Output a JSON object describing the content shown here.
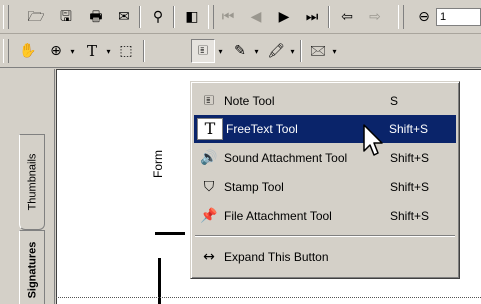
{
  "toolbar1": {
    "buttons": [
      {
        "name": "open-icon",
        "glyph": "🗁"
      },
      {
        "name": "save-icon",
        "glyph": "🖫"
      },
      {
        "name": "print-icon",
        "glyph": "🖶"
      },
      {
        "name": "email-icon",
        "glyph": "✉"
      },
      {
        "name": "find-icon",
        "glyph": "⚲"
      },
      {
        "name": "show-navigation-pane-icon",
        "glyph": "◧"
      },
      {
        "name": "first-page-icon",
        "glyph": "⏮"
      },
      {
        "name": "previous-page-icon",
        "glyph": "◀"
      },
      {
        "name": "next-page-icon",
        "glyph": "▶"
      },
      {
        "name": "last-page-icon",
        "glyph": "⏭"
      },
      {
        "name": "go-back-icon",
        "glyph": "⇦"
      },
      {
        "name": "go-forward-icon",
        "glyph": "⇨"
      },
      {
        "name": "zoom-out-icon",
        "glyph": "⊖"
      }
    ],
    "zoom_field_partial": "1"
  },
  "toolbar2": {
    "buttons": [
      {
        "name": "hand-tool-icon",
        "glyph": "✋"
      },
      {
        "name": "zoom-in-tool-icon",
        "glyph": "⊕"
      },
      {
        "name": "text-select-tool-icon",
        "glyph": "T"
      },
      {
        "name": "graphics-select-tool-icon",
        "glyph": "⬚"
      },
      {
        "name": "note-tool-icon",
        "glyph": "🗉"
      },
      {
        "name": "pencil-tool-icon",
        "glyph": "✎"
      },
      {
        "name": "highlighter-tool-icon",
        "glyph": "🖍"
      },
      {
        "name": "digital-signature-tool-icon",
        "glyph": "🖂"
      }
    ]
  },
  "nav": {
    "thumbnails_tab": "Thumbnails",
    "signatures_tab": "Signatures"
  },
  "document": {
    "form_label": "Form"
  },
  "menu": {
    "items": [
      {
        "label": "Note Tool",
        "shortcut": "S",
        "icon": "note-icon",
        "glyph": "🗉",
        "selected": false
      },
      {
        "label": "FreeText Tool",
        "shortcut": "Shift+S",
        "icon": "free-text-icon",
        "glyph": "T",
        "selected": true
      },
      {
        "label": "Sound Attachment Tool",
        "shortcut": "Shift+S",
        "icon": "speaker-icon",
        "glyph": "🔊",
        "selected": false
      },
      {
        "label": "Stamp Tool",
        "shortcut": "Shift+S",
        "icon": "stamp-icon",
        "glyph": "⛉",
        "selected": false
      },
      {
        "label": "File Attachment Tool",
        "shortcut": "Shift+S",
        "icon": "pushpin-icon",
        "glyph": "📌",
        "selected": false
      }
    ],
    "expand": {
      "label": "Expand This Button",
      "icon": "expand-arrows-icon",
      "glyph": "↔"
    }
  },
  "colors": {
    "chrome": "#d4d0c8",
    "selection": "#0a246a",
    "document": "#ffffff"
  }
}
